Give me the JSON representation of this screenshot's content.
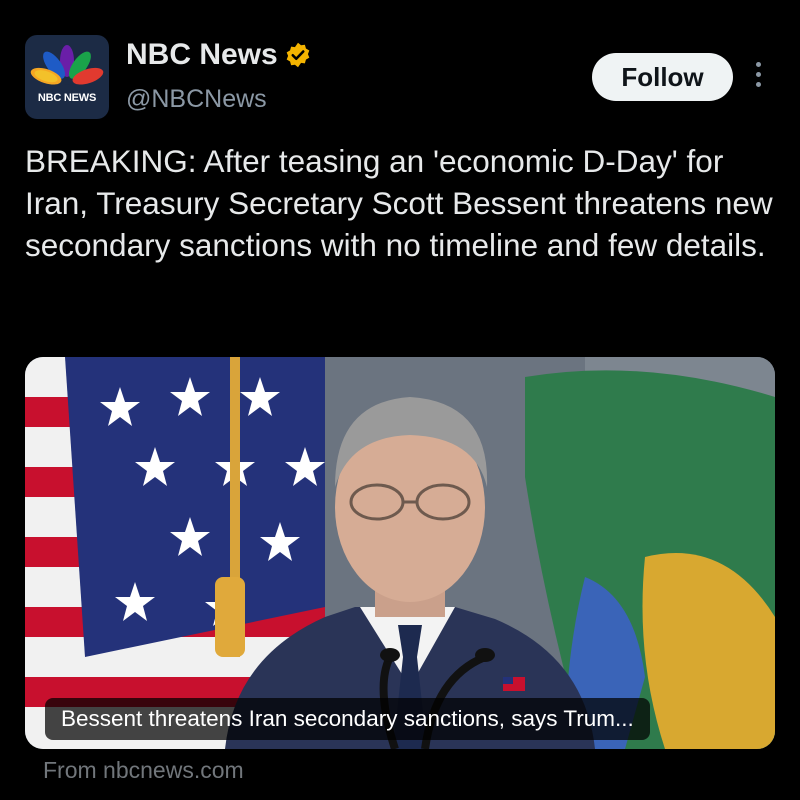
{
  "author": {
    "display_name": "NBC News",
    "handle": "@NBCNews",
    "avatar_text": "NBC NEWS",
    "verified_icon": "verified-badge-icon",
    "verified_color": "#f4b400"
  },
  "actions": {
    "follow_label": "Follow",
    "more_icon": "more-vertical-icon"
  },
  "tweet": {
    "text": "BREAKING: After teasing an 'economic D-Day' for Iran, Treasury Secretary Scott Bessent threatens new secondary sanctions with no timeline and few details."
  },
  "link_card": {
    "headline": "Bessent threatens Iran secondary sanctions, says Trum...",
    "source": "From nbcnews.com"
  },
  "colors": {
    "background": "#000000",
    "text": "#e7e9ea",
    "secondary_text": "#8b98a5",
    "follow_bg": "#eff3f4"
  }
}
